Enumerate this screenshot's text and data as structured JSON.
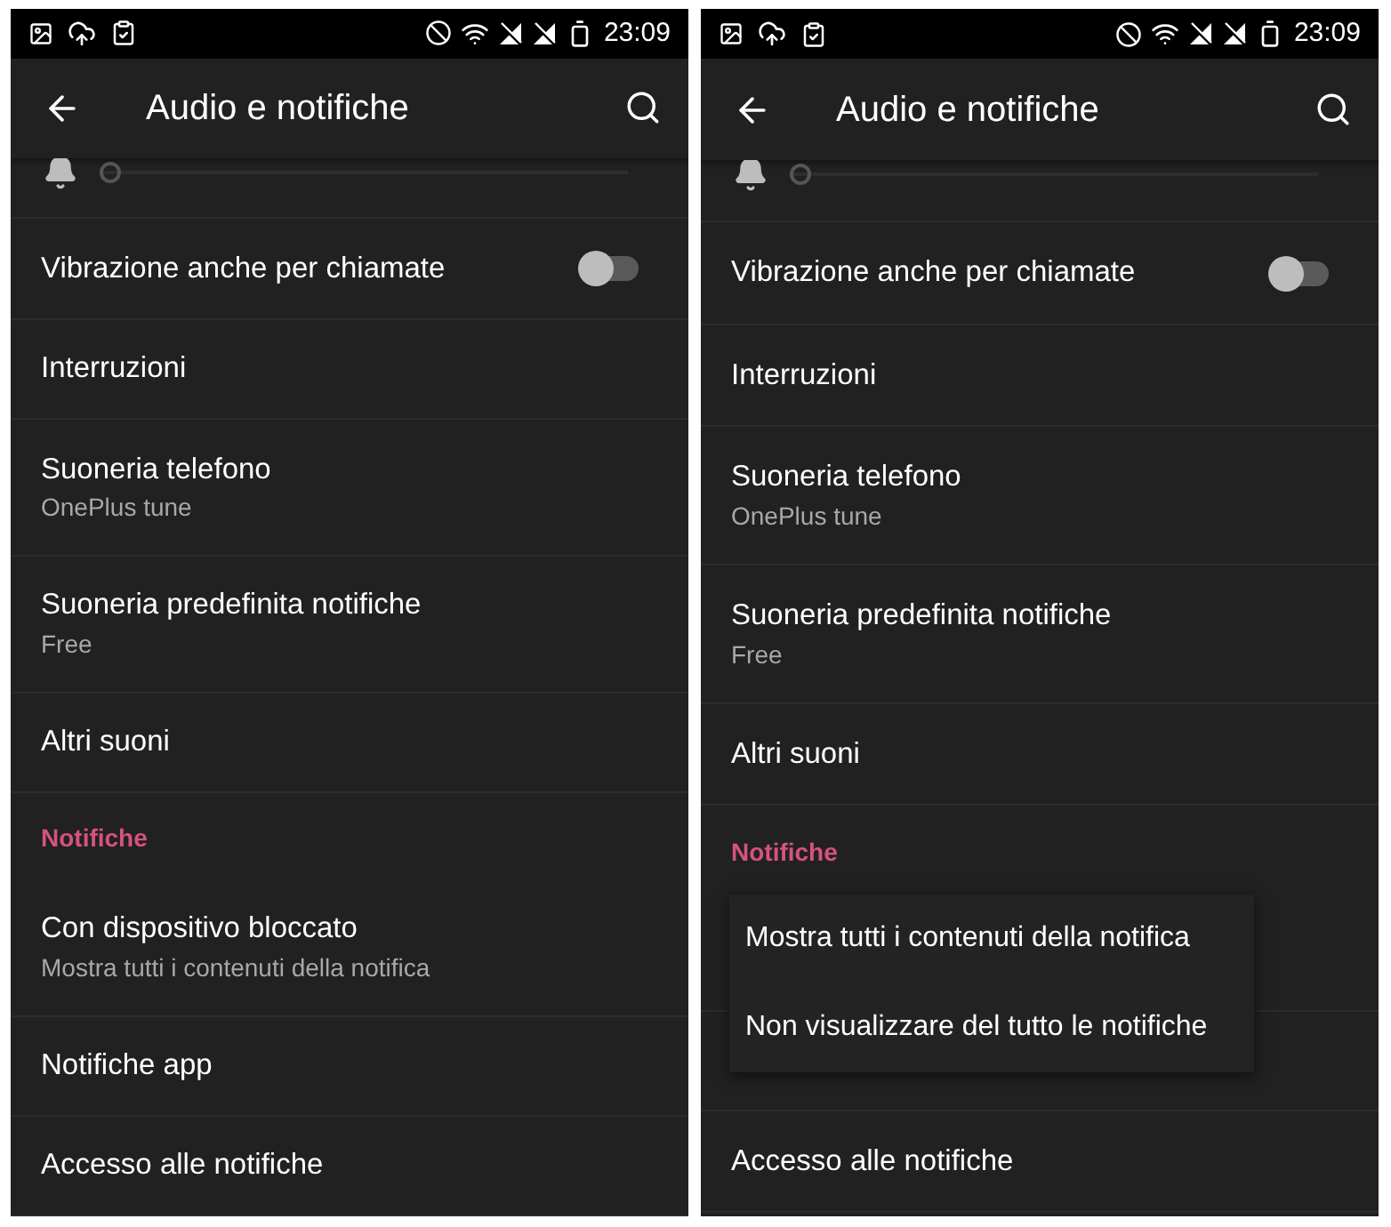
{
  "screens": [
    {
      "status_bar": {
        "time": "23:09"
      },
      "app_bar": {
        "title": "Audio e notifiche"
      },
      "items": [
        {
          "kind": "slider",
          "level": 0
        },
        {
          "kind": "toggle",
          "title": "Vibrazione anche per chiamate",
          "on": false
        },
        {
          "kind": "row",
          "title": "Interruzioni"
        },
        {
          "kind": "row",
          "title": "Suoneria telefono",
          "subtitle": "OnePlus tune"
        },
        {
          "kind": "row",
          "title": "Suoneria predefinita notifiche",
          "subtitle": "Free"
        },
        {
          "kind": "row",
          "title": "Altri suoni"
        },
        {
          "kind": "header",
          "title": "Notifiche"
        },
        {
          "kind": "row",
          "title": "Con dispositivo bloccato",
          "subtitle": "Mostra tutti i contenuti della notifica"
        },
        {
          "kind": "row",
          "title": "Notifiche app"
        },
        {
          "kind": "row",
          "title": "Accesso alle notifiche"
        }
      ]
    },
    {
      "status_bar": {
        "time": "23:09"
      },
      "app_bar": {
        "title": "Audio e notifiche"
      },
      "items": [
        {
          "kind": "slider",
          "level": 0
        },
        {
          "kind": "toggle",
          "title": "Vibrazione anche per chiamate",
          "on": false
        },
        {
          "kind": "row",
          "title": "Interruzioni"
        },
        {
          "kind": "row",
          "title": "Suoneria telefono",
          "subtitle": "OnePlus tune"
        },
        {
          "kind": "row",
          "title": "Suoneria predefinita notifiche",
          "subtitle": "Free"
        },
        {
          "kind": "row",
          "title": "Altri suoni"
        },
        {
          "kind": "header",
          "title": "Notifiche"
        },
        {
          "kind": "menu",
          "options": [
            "Mostra tutti i contenuti della notifica",
            "Non visualizzare del tutto le notifiche"
          ]
        },
        {
          "kind": "row",
          "title": "Accesso alle notifiche"
        }
      ]
    }
  ]
}
